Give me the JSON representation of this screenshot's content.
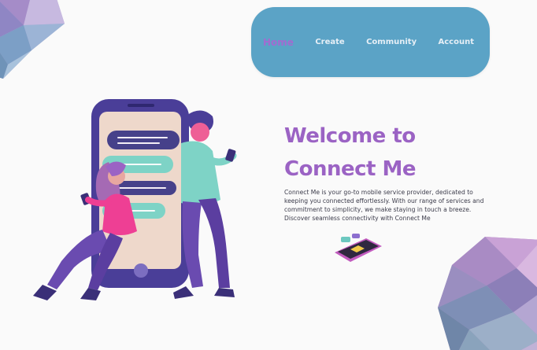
{
  "nav": {
    "items": [
      {
        "label": "Home",
        "active": true
      },
      {
        "label": "Create",
        "active": false
      },
      {
        "label": "Community",
        "active": false
      },
      {
        "label": "Account",
        "active": false
      }
    ]
  },
  "hero": {
    "title_line1": "Welcome to",
    "title_line2": "Connect Me",
    "description": "Connect Me is your go-to mobile service provider, dedicated to keeping you connected effortlessly. With our range of services and commitment to simplicity, we make staying in touch a breeze. Discover seamless connectivity with Connect Me"
  },
  "colors": {
    "nav_background": "#5ba3c6",
    "accent_purple": "#9b63c4",
    "nav_text": "#e6eff6"
  },
  "icons": {
    "illustration": "people-texting-phone-illustration",
    "mini_phone": "chat-phone-icon"
  }
}
